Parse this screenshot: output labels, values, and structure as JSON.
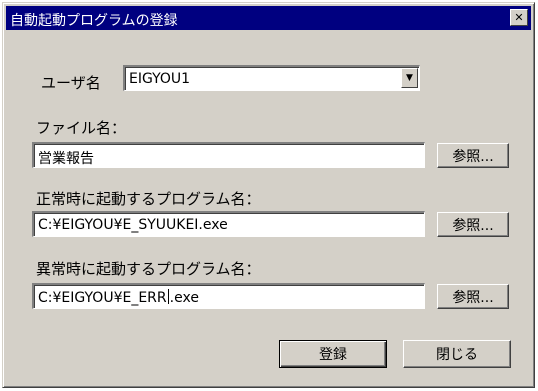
{
  "window": {
    "title": "自動起動プログラムの登録",
    "close_glyph": "✕"
  },
  "user": {
    "label": "ユーザ名",
    "value": "EIGYOU1",
    "dropdown_glyph": "▼"
  },
  "file": {
    "label": "ファイル名：",
    "value": "営業報告",
    "browse_label": "参照..."
  },
  "normal_program": {
    "label": "正常時に起動するプログラム名：",
    "value": "C:¥EIGYOU¥E_SYUUKEI.exe",
    "browse_label": "参照..."
  },
  "error_program": {
    "label": "異常時に起動するプログラム名：",
    "value_before_caret": "C:¥EIGYOU¥E_ERR",
    "value_after_caret": ".exe",
    "browse_label": "参照..."
  },
  "buttons": {
    "register_label": "登録",
    "close_label": "閉じる"
  },
  "colors": {
    "titlebar": "#000080",
    "face": "#d4d0c8"
  }
}
